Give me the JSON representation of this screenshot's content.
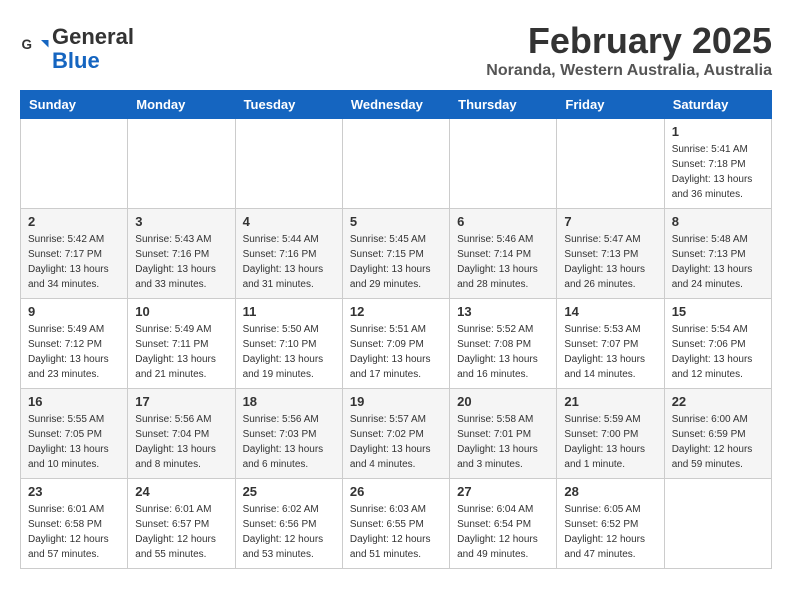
{
  "header": {
    "logo_line1": "General",
    "logo_line2": "Blue",
    "title": "February 2025",
    "subtitle": "Noranda, Western Australia, Australia"
  },
  "weekdays": [
    "Sunday",
    "Monday",
    "Tuesday",
    "Wednesday",
    "Thursday",
    "Friday",
    "Saturday"
  ],
  "weeks": [
    [
      {
        "day": "",
        "info": ""
      },
      {
        "day": "",
        "info": ""
      },
      {
        "day": "",
        "info": ""
      },
      {
        "day": "",
        "info": ""
      },
      {
        "day": "",
        "info": ""
      },
      {
        "day": "",
        "info": ""
      },
      {
        "day": "1",
        "info": "Sunrise: 5:41 AM\nSunset: 7:18 PM\nDaylight: 13 hours\nand 36 minutes."
      }
    ],
    [
      {
        "day": "2",
        "info": "Sunrise: 5:42 AM\nSunset: 7:17 PM\nDaylight: 13 hours\nand 34 minutes."
      },
      {
        "day": "3",
        "info": "Sunrise: 5:43 AM\nSunset: 7:16 PM\nDaylight: 13 hours\nand 33 minutes."
      },
      {
        "day": "4",
        "info": "Sunrise: 5:44 AM\nSunset: 7:16 PM\nDaylight: 13 hours\nand 31 minutes."
      },
      {
        "day": "5",
        "info": "Sunrise: 5:45 AM\nSunset: 7:15 PM\nDaylight: 13 hours\nand 29 minutes."
      },
      {
        "day": "6",
        "info": "Sunrise: 5:46 AM\nSunset: 7:14 PM\nDaylight: 13 hours\nand 28 minutes."
      },
      {
        "day": "7",
        "info": "Sunrise: 5:47 AM\nSunset: 7:13 PM\nDaylight: 13 hours\nand 26 minutes."
      },
      {
        "day": "8",
        "info": "Sunrise: 5:48 AM\nSunset: 7:13 PM\nDaylight: 13 hours\nand 24 minutes."
      }
    ],
    [
      {
        "day": "9",
        "info": "Sunrise: 5:49 AM\nSunset: 7:12 PM\nDaylight: 13 hours\nand 23 minutes."
      },
      {
        "day": "10",
        "info": "Sunrise: 5:49 AM\nSunset: 7:11 PM\nDaylight: 13 hours\nand 21 minutes."
      },
      {
        "day": "11",
        "info": "Sunrise: 5:50 AM\nSunset: 7:10 PM\nDaylight: 13 hours\nand 19 minutes."
      },
      {
        "day": "12",
        "info": "Sunrise: 5:51 AM\nSunset: 7:09 PM\nDaylight: 13 hours\nand 17 minutes."
      },
      {
        "day": "13",
        "info": "Sunrise: 5:52 AM\nSunset: 7:08 PM\nDaylight: 13 hours\nand 16 minutes."
      },
      {
        "day": "14",
        "info": "Sunrise: 5:53 AM\nSunset: 7:07 PM\nDaylight: 13 hours\nand 14 minutes."
      },
      {
        "day": "15",
        "info": "Sunrise: 5:54 AM\nSunset: 7:06 PM\nDaylight: 13 hours\nand 12 minutes."
      }
    ],
    [
      {
        "day": "16",
        "info": "Sunrise: 5:55 AM\nSunset: 7:05 PM\nDaylight: 13 hours\nand 10 minutes."
      },
      {
        "day": "17",
        "info": "Sunrise: 5:56 AM\nSunset: 7:04 PM\nDaylight: 13 hours\nand 8 minutes."
      },
      {
        "day": "18",
        "info": "Sunrise: 5:56 AM\nSunset: 7:03 PM\nDaylight: 13 hours\nand 6 minutes."
      },
      {
        "day": "19",
        "info": "Sunrise: 5:57 AM\nSunset: 7:02 PM\nDaylight: 13 hours\nand 4 minutes."
      },
      {
        "day": "20",
        "info": "Sunrise: 5:58 AM\nSunset: 7:01 PM\nDaylight: 13 hours\nand 3 minutes."
      },
      {
        "day": "21",
        "info": "Sunrise: 5:59 AM\nSunset: 7:00 PM\nDaylight: 13 hours\nand 1 minute."
      },
      {
        "day": "22",
        "info": "Sunrise: 6:00 AM\nSunset: 6:59 PM\nDaylight: 12 hours\nand 59 minutes."
      }
    ],
    [
      {
        "day": "23",
        "info": "Sunrise: 6:01 AM\nSunset: 6:58 PM\nDaylight: 12 hours\nand 57 minutes."
      },
      {
        "day": "24",
        "info": "Sunrise: 6:01 AM\nSunset: 6:57 PM\nDaylight: 12 hours\nand 55 minutes."
      },
      {
        "day": "25",
        "info": "Sunrise: 6:02 AM\nSunset: 6:56 PM\nDaylight: 12 hours\nand 53 minutes."
      },
      {
        "day": "26",
        "info": "Sunrise: 6:03 AM\nSunset: 6:55 PM\nDaylight: 12 hours\nand 51 minutes."
      },
      {
        "day": "27",
        "info": "Sunrise: 6:04 AM\nSunset: 6:54 PM\nDaylight: 12 hours\nand 49 minutes."
      },
      {
        "day": "28",
        "info": "Sunrise: 6:05 AM\nSunset: 6:52 PM\nDaylight: 12 hours\nand 47 minutes."
      },
      {
        "day": "",
        "info": ""
      }
    ]
  ]
}
